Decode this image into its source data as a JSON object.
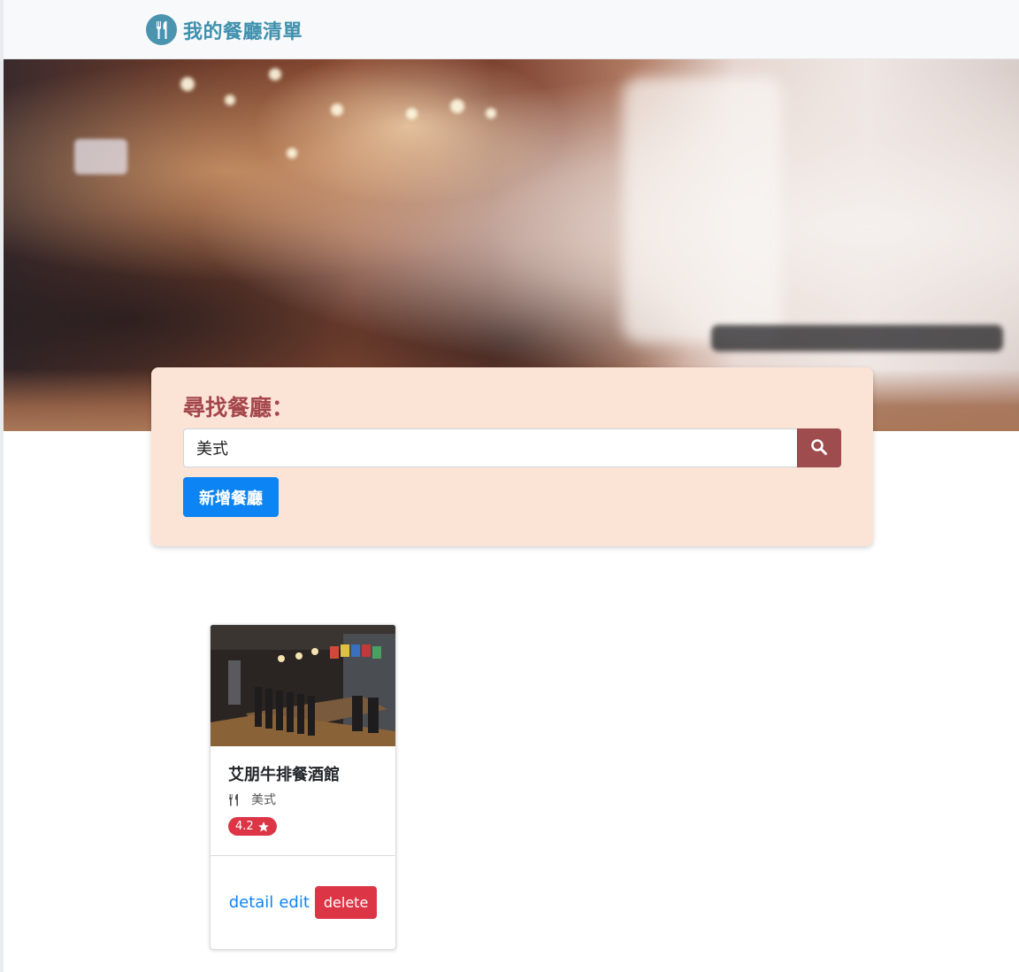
{
  "app": {
    "title": "我的餐廳清單",
    "brand_color": "#3e90ad"
  },
  "search": {
    "title": "尋找餐廳：",
    "query": "美式",
    "button_icon": "search-icon",
    "add_label": "新增餐廳"
  },
  "restaurants": [
    {
      "name": "艾朋牛排餐酒館",
      "category": "美式",
      "category_icon": "utensils-icon",
      "rating": "4.2",
      "actions": {
        "detail": "detail",
        "edit": "edit",
        "delete": "delete"
      }
    }
  ],
  "colors": {
    "panel_bg": "#fbe3d6",
    "panel_title": "#a4474c",
    "search_button": "#9e4c4e",
    "primary": "#0d84f3",
    "danger": "#dc3545"
  }
}
